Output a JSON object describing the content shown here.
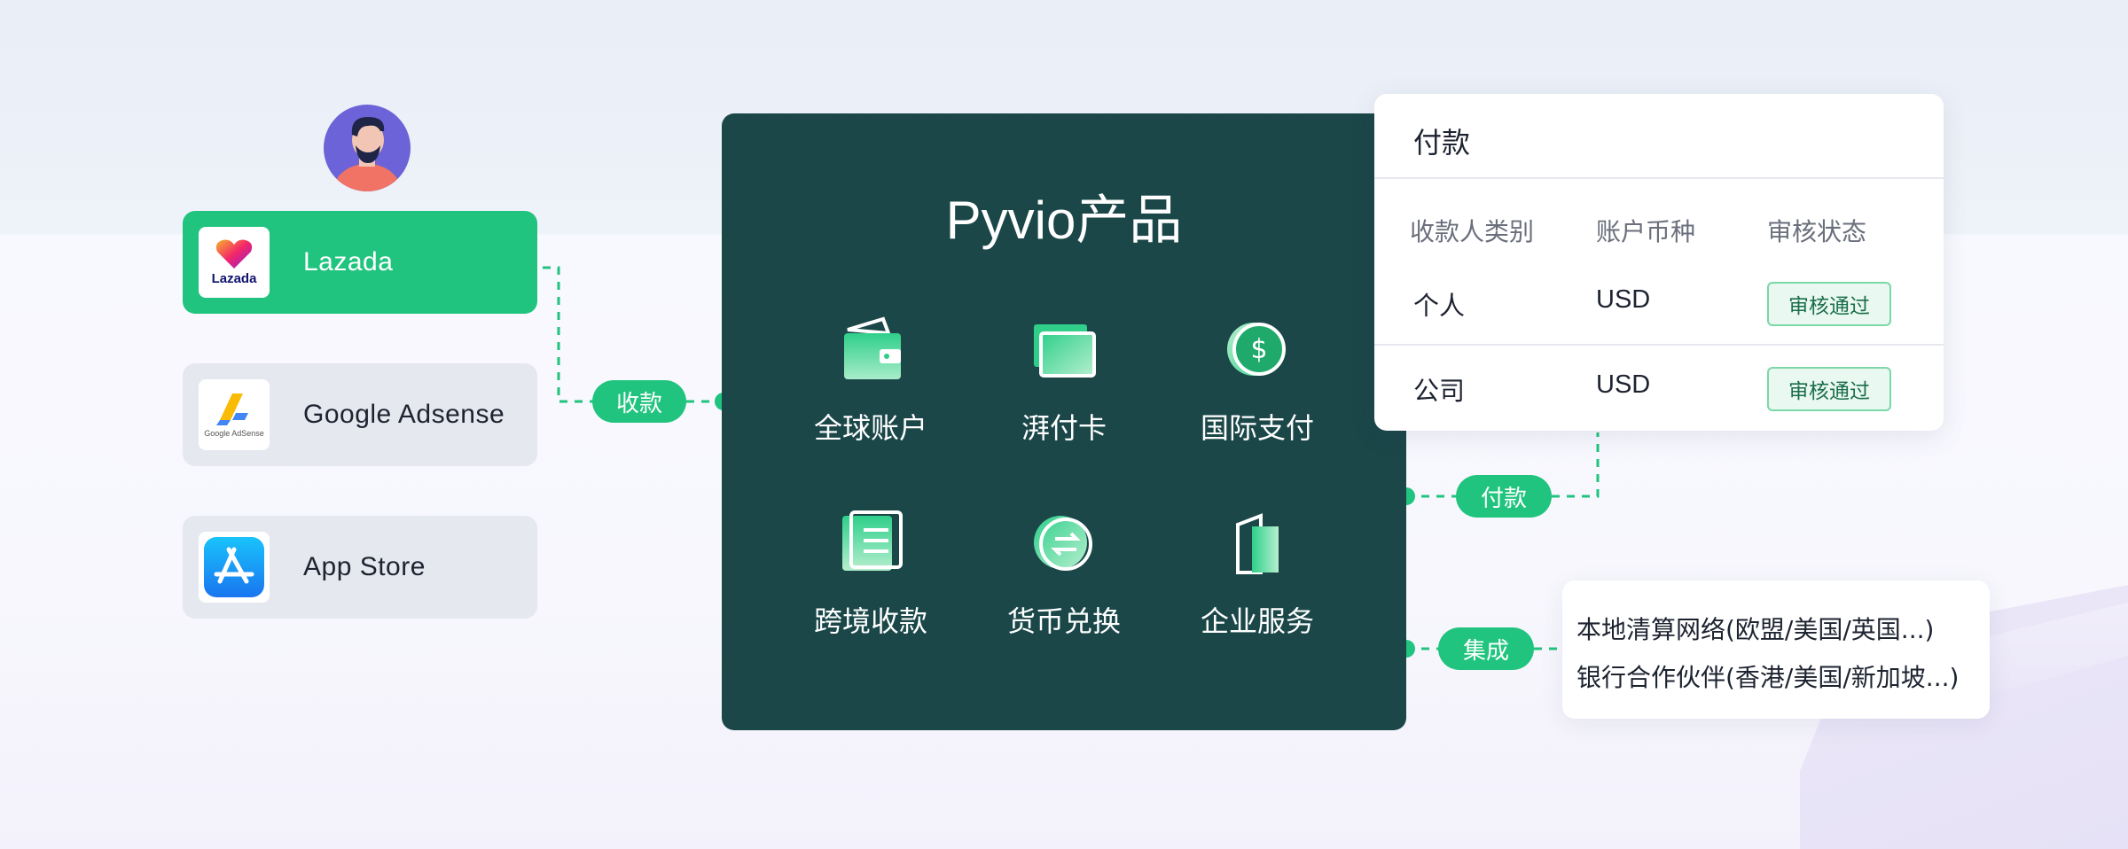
{
  "platforms": [
    {
      "name": "Lazada",
      "logo_icon": "lazada-logo",
      "logo_text": "Lazada",
      "active": true
    },
    {
      "name": "Google Adsense",
      "logo_icon": "google-adsense-logo",
      "logo_text": "Google AdSense",
      "active": false
    },
    {
      "name": "App Store",
      "logo_icon": "app-store-logo",
      "active": false
    }
  ],
  "connectors": {
    "collect_label": "收款",
    "pay_label": "付款",
    "integrate_label": "集成"
  },
  "product": {
    "title": "Pyvio产品",
    "features": [
      {
        "label": "全球账户",
        "icon": "wallet-icon"
      },
      {
        "label": "湃付卡",
        "icon": "card-icon"
      },
      {
        "label": "国际支付",
        "icon": "dollar-coin-icon"
      },
      {
        "label": "跨境收款",
        "icon": "document-icon"
      },
      {
        "label": "货币兑换",
        "icon": "exchange-icon"
      },
      {
        "label": "企业服务",
        "icon": "building-icon"
      }
    ]
  },
  "payment": {
    "title": "付款",
    "columns": [
      "收款人类别",
      "账户币种",
      "审核状态"
    ],
    "rows": [
      {
        "type": "个人",
        "currency": "USD",
        "status": "审核通过"
      },
      {
        "type": "公司",
        "currency": "USD",
        "status": "审核通过"
      }
    ]
  },
  "integration": {
    "lines": [
      "本地清算网络(欧盟/美国/英国...)",
      "银行合作伙伴(香港/美国/新加坡...)"
    ]
  },
  "colors": {
    "accent_green": "#21c47e",
    "product_bg": "#1b4749",
    "avatar_bg": "#6c63d8"
  }
}
